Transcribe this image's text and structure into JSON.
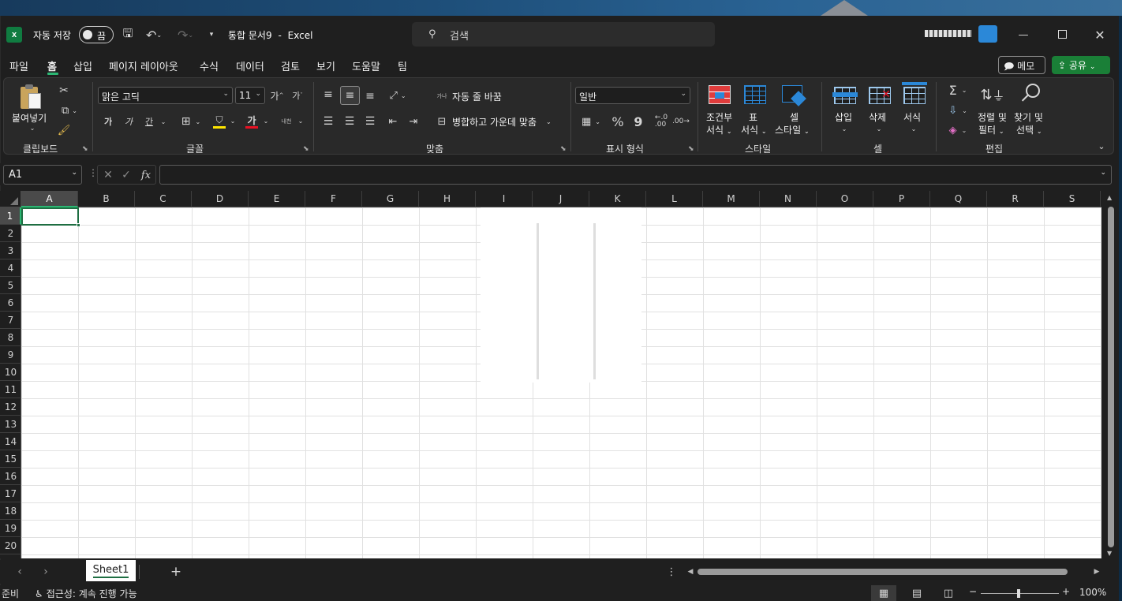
{
  "title_bar": {
    "autosave_label": "자동 저장",
    "autosave_state": "끔",
    "doc_title": "통합 문서9",
    "separator": "-",
    "app_name": "Excel",
    "search_placeholder": "검색"
  },
  "tabs": [
    "파일",
    "홈",
    "삽입",
    "페이지 레이아웃",
    "수식",
    "데이터",
    "검토",
    "보기",
    "도움말",
    "팀"
  ],
  "active_tab": "홈",
  "memo_button": "메모",
  "share_button": "공유",
  "ribbon": {
    "clipboard": {
      "paste": "붙여넣기",
      "label": "클립보드"
    },
    "font": {
      "name": "맑은 고딕",
      "size": "11",
      "label": "글꼴",
      "bold": "가",
      "italic": "가",
      "underline": "간",
      "color_glyph": "가",
      "phonetic": "내천"
    },
    "alignment": {
      "wrap": "자동 줄 바꿈",
      "merge": "병합하고 가운데 맞춤",
      "label": "맞춤",
      "wrap_icon": "가나"
    },
    "number": {
      "format": "일반",
      "label": "표시 형식"
    },
    "styles": {
      "conditional_1": "조건부",
      "conditional_2": "서식",
      "table_1": "표",
      "table_2": "서식",
      "cell_1": "셀",
      "cell_2": "스타일",
      "label": "스타일"
    },
    "cells": {
      "insert": "삽입",
      "delete": "삭제",
      "format": "서식",
      "label": "셀"
    },
    "editing": {
      "sort_1": "정렬 및",
      "sort_2": "필터",
      "find_1": "찾기 및",
      "find_2": "선택",
      "label": "편집"
    }
  },
  "formula_bar": {
    "name_box": "A1",
    "cancel": "✕",
    "enter": "✓",
    "fx": "fx",
    "value": ""
  },
  "columns": [
    "A",
    "B",
    "C",
    "D",
    "E",
    "F",
    "G",
    "H",
    "I",
    "J",
    "K",
    "L",
    "M",
    "N",
    "O",
    "P",
    "Q",
    "R",
    "S"
  ],
  "rows": [
    "1",
    "2",
    "3",
    "4",
    "5",
    "6",
    "7",
    "8",
    "9",
    "10",
    "11",
    "12",
    "13",
    "14",
    "15",
    "16",
    "17",
    "18",
    "19",
    "20"
  ],
  "sheet_tabs": [
    "Sheet1"
  ],
  "status_bar": {
    "ready": "준비",
    "accessibility": "접근성: 계속 진행 가능",
    "zoom": "100%",
    "minus": "−",
    "plus": "+"
  },
  "colors": {
    "excel_green": "#1e6e42",
    "share_green": "#1a7f37",
    "accent": "#2b88d8"
  }
}
